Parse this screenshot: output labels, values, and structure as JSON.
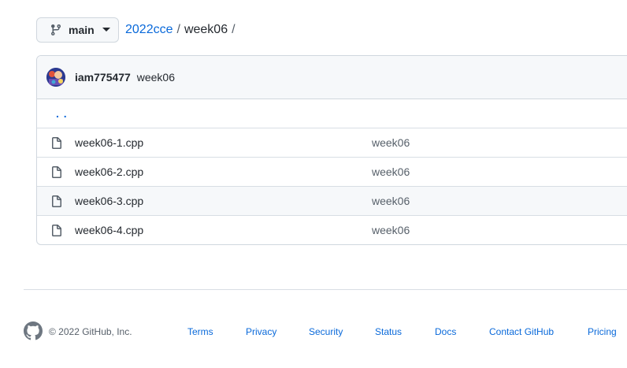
{
  "branch": {
    "label": "main"
  },
  "breadcrumb": {
    "repo": "2022cce",
    "separator": "/",
    "folder": "week06",
    "trailing_separator": "/"
  },
  "latest_commit": {
    "author": "iam775477",
    "message": "week06"
  },
  "updir": {
    "label": ". ."
  },
  "files": [
    {
      "name": "week06-1.cpp",
      "commit": "week06"
    },
    {
      "name": "week06-2.cpp",
      "commit": "week06"
    },
    {
      "name": "week06-3.cpp",
      "commit": "week06"
    },
    {
      "name": "week06-4.cpp",
      "commit": "week06"
    }
  ],
  "footer": {
    "copyright": "© 2022 GitHub, Inc.",
    "links": [
      "Terms",
      "Privacy",
      "Security",
      "Status",
      "Docs",
      "Contact GitHub",
      "Pricing"
    ]
  },
  "colors": {
    "link": "#0969da",
    "text": "#24292f",
    "muted": "#57606a",
    "border": "#d0d7de",
    "header_bg": "#f6f8fa"
  },
  "icons": {
    "branch": "git-branch-icon",
    "caret": "caret-down-icon",
    "file": "file-icon",
    "github": "github-mark-icon"
  }
}
